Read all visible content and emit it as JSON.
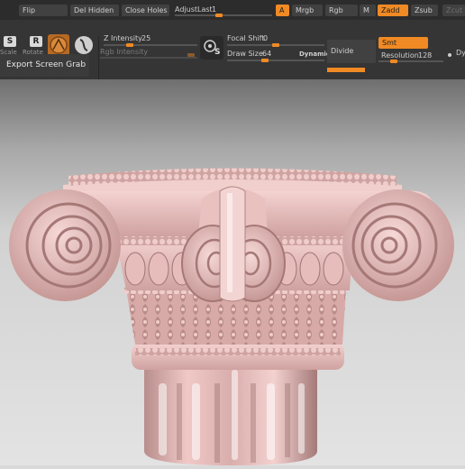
{
  "top_row": {
    "flip": "Flip",
    "del_hidden": "Del Hidden",
    "close_holes": "Close Holes",
    "adjust_last_label": "AdjustLast",
    "adjust_last_value": "1",
    "adjust_last_level": 0.45,
    "a": "A",
    "mrgb": "Mrgb",
    "rgb": "Rgb",
    "m": "M",
    "zadd": "Zadd",
    "zsub": "Zsub",
    "zcut": "Zcut"
  },
  "left_icons": {
    "scale": "Scale",
    "rotate": "Rotate",
    "scale_key": "S",
    "rotate_key": "R"
  },
  "tooltip": "Export Screen Grab",
  "sliders": {
    "z_intensity_label": "Z Intensity",
    "z_intensity_value": "25",
    "rgb_intensity_label": "Rgb Intensity",
    "focal_shift_label": "Focal Shift",
    "focal_shift_value": "0",
    "draw_size_label": "Draw Size",
    "draw_size_value": "64",
    "dynamic": "Dynamic",
    "resolution_label": "Resolution",
    "resolution_value": "128"
  },
  "brush_icon_key": "S",
  "divide": "Divide",
  "smt": "Smt",
  "dy": "Dy",
  "colors": {
    "accent": "#f08a24",
    "toolbar": "#353535",
    "model": "#e7b7b5"
  }
}
